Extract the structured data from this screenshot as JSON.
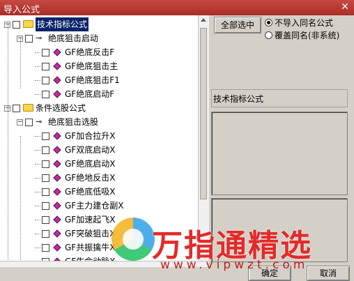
{
  "window": {
    "title": "导入公式",
    "close_glyph": "✕"
  },
  "tree": [
    {
      "label": "技术指标公式",
      "level": 0,
      "type": "folder",
      "expanded": true,
      "selected": true
    },
    {
      "label": "绝底狙击启动",
      "level": 1,
      "type": "key",
      "expanded": true
    },
    {
      "label": "GF绝底反击F",
      "level": 2,
      "type": "item"
    },
    {
      "label": "GF绝底狙击主",
      "level": 2,
      "type": "item"
    },
    {
      "label": "GF绝底狙击F1",
      "level": 2,
      "type": "item"
    },
    {
      "label": "GF绝底启动F",
      "level": 2,
      "type": "item"
    },
    {
      "label": "条件选股公式",
      "level": 0,
      "type": "folder",
      "expanded": true
    },
    {
      "label": "绝底狙击选股",
      "level": 1,
      "type": "key",
      "expanded": true
    },
    {
      "label": "GF加合拉升X",
      "level": 2,
      "type": "item"
    },
    {
      "label": "GF双底启动X",
      "level": 2,
      "type": "item"
    },
    {
      "label": "GF绝底启动X",
      "level": 2,
      "type": "item"
    },
    {
      "label": "GF绝地反击X",
      "level": 2,
      "type": "item"
    },
    {
      "label": "GF绝底低吸X",
      "level": 2,
      "type": "item"
    },
    {
      "label": "GF主力建仓副X",
      "level": 2,
      "type": "item"
    },
    {
      "label": "GF加速起飞X",
      "level": 2,
      "type": "item"
    },
    {
      "label": "GF突破狙击X",
      "level": 2,
      "type": "item"
    },
    {
      "label": "GF共振擒牛X",
      "level": 2,
      "type": "item"
    },
    {
      "label": "GF生命动脉X",
      "level": 2,
      "type": "item"
    }
  ],
  "options": {
    "select_all_label": "全部选中",
    "radio_no_import": "不导入同名公式",
    "radio_overwrite": "覆盖同名(非系统)",
    "selected": "no_import"
  },
  "info": {
    "type_label": "技术指标公式"
  },
  "footer": {
    "ok_label": "确定",
    "cancel_label": "取消"
  },
  "watermark": {
    "text": "万指通精选",
    "url": "www.vipwzt.com"
  }
}
